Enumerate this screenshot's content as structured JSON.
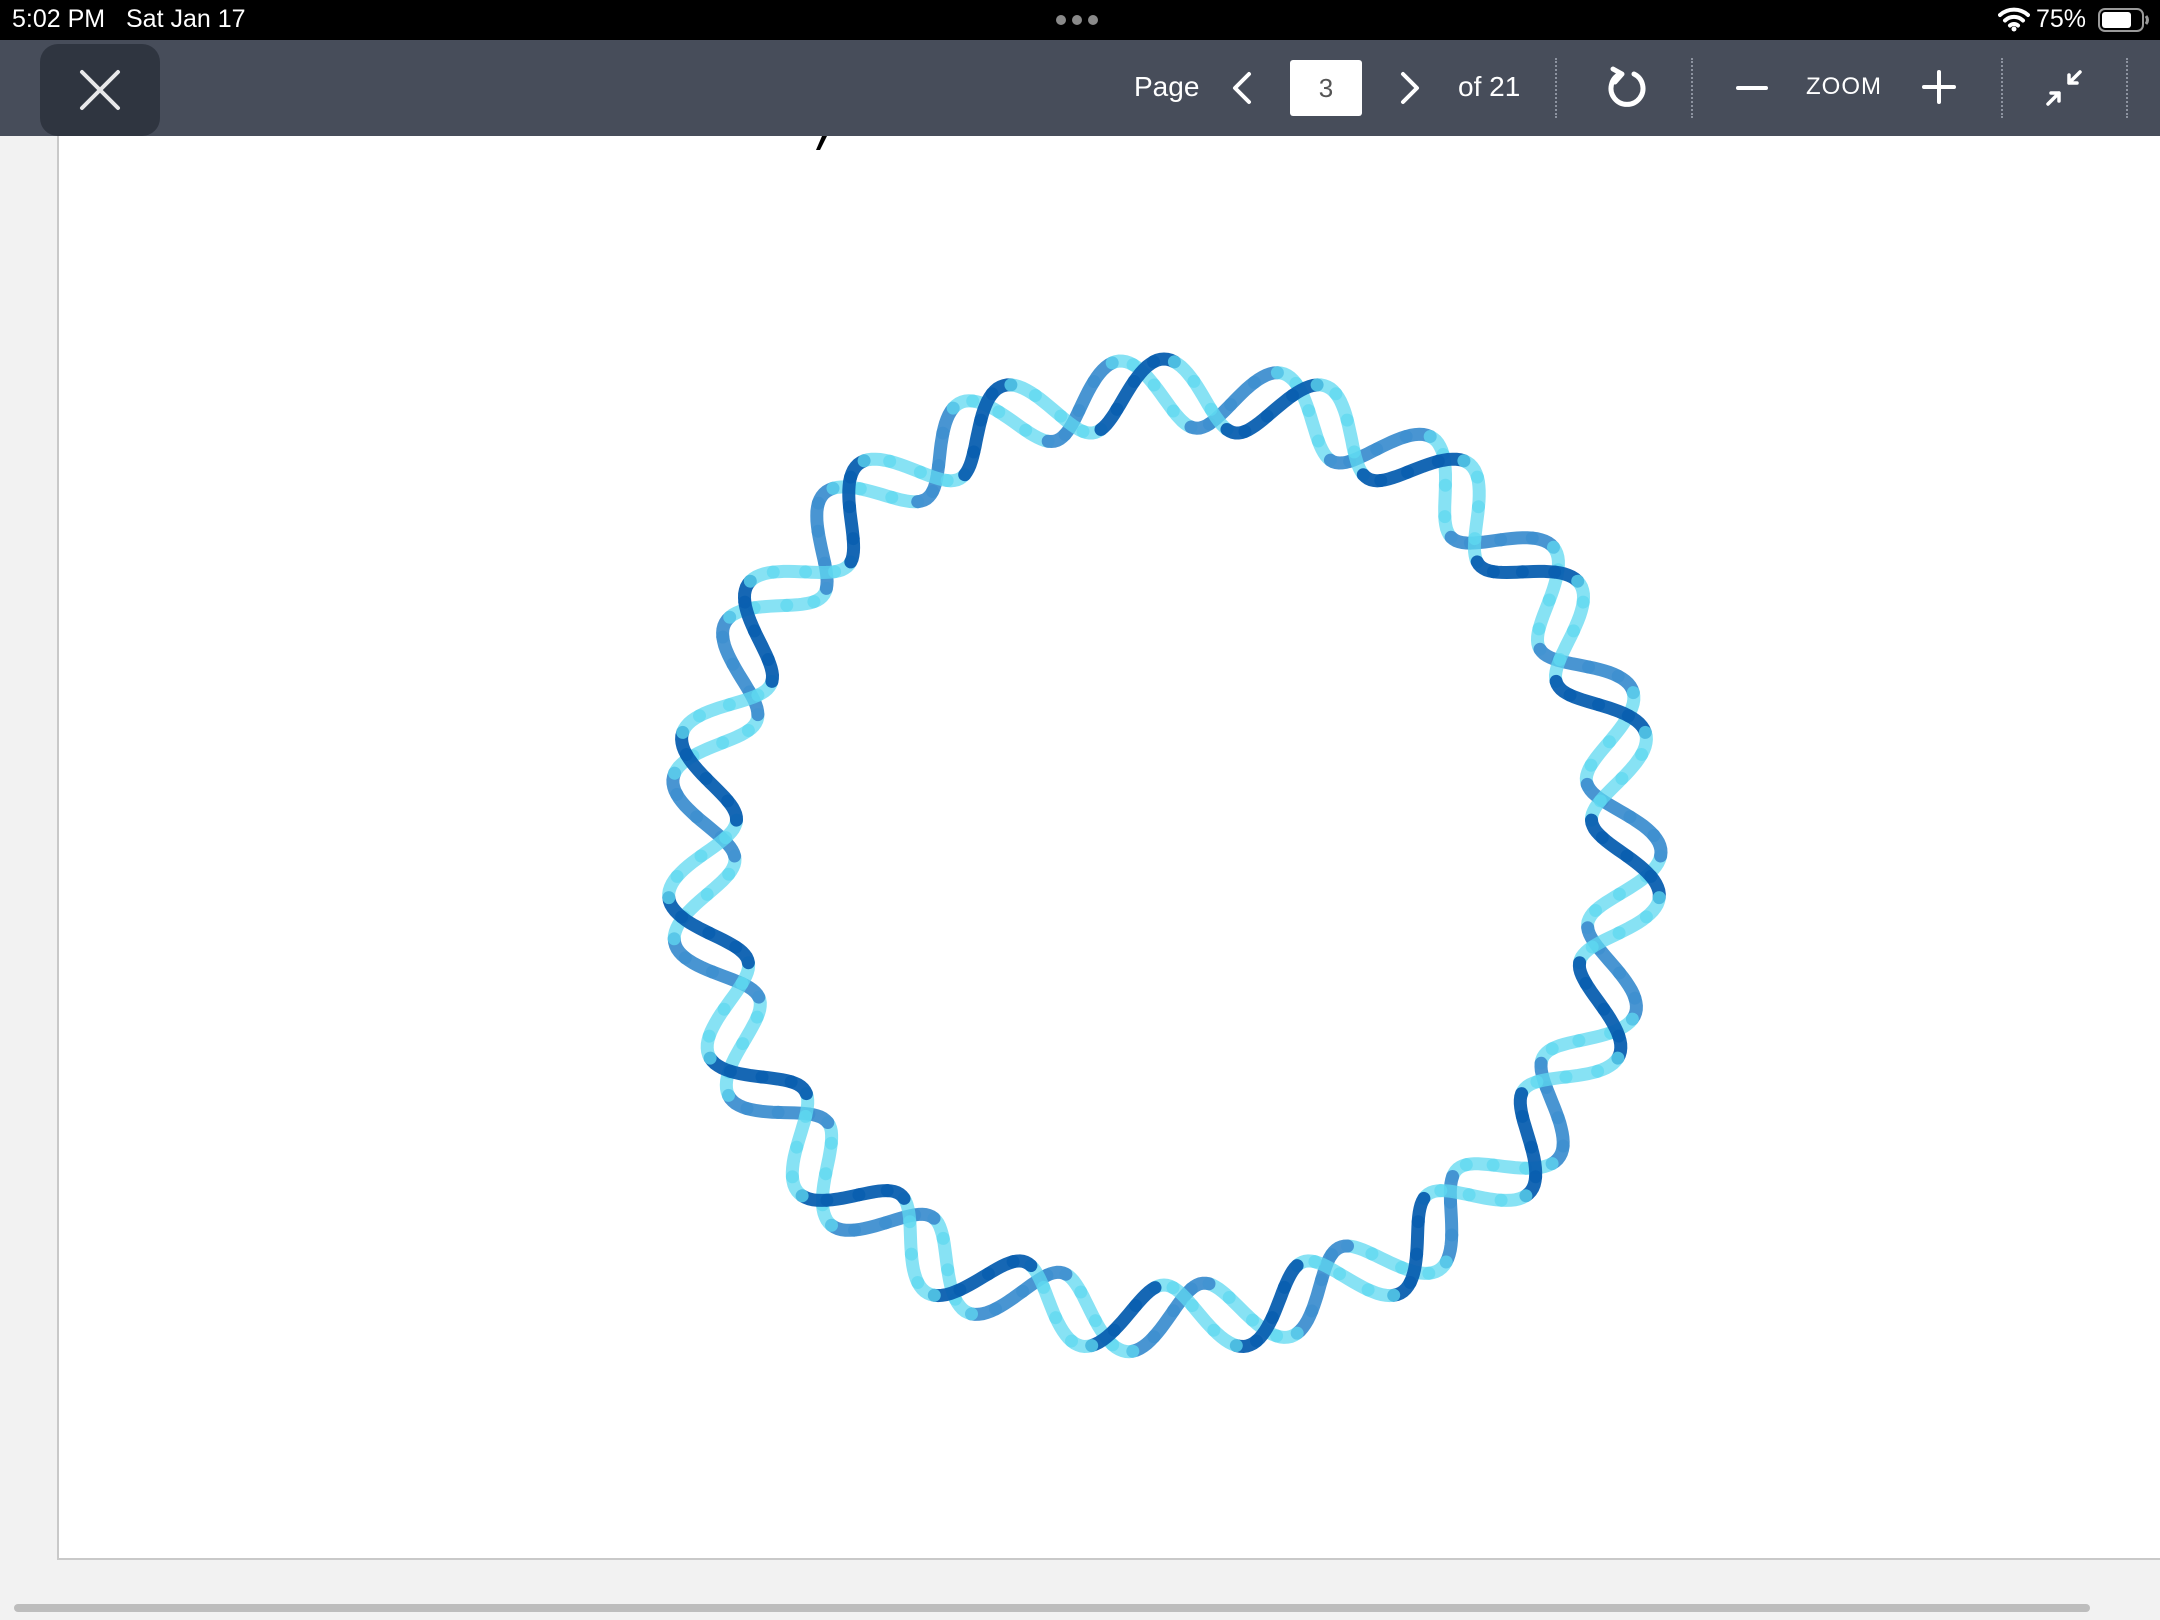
{
  "status_bar": {
    "time": "5:02 PM",
    "date": "Sat Jan 17",
    "battery_percent": "75%",
    "battery_level": 0.75,
    "wifi_icon": "wifi-icon",
    "battery_icon": "battery-icon"
  },
  "toolbar": {
    "close_icon": "close-icon",
    "page_label": "Page",
    "current_page": "3",
    "total_label": "of 21",
    "prev_icon": "chevron-left-icon",
    "next_icon": "chevron-right-icon",
    "rotate_icon": "rotate-icon",
    "zoom_out_icon": "minus-icon",
    "zoom_label": "ZOOM",
    "zoom_in_icon": "plus-icon",
    "collapse_icon": "collapse-arrows-icon"
  },
  "document": {
    "figure": "circular-dna-helix-image",
    "colors": {
      "helix_dark": "#0a5fb0",
      "helix_mid": "#3f8fd0",
      "helix_light": "#5fd8f0"
    }
  }
}
